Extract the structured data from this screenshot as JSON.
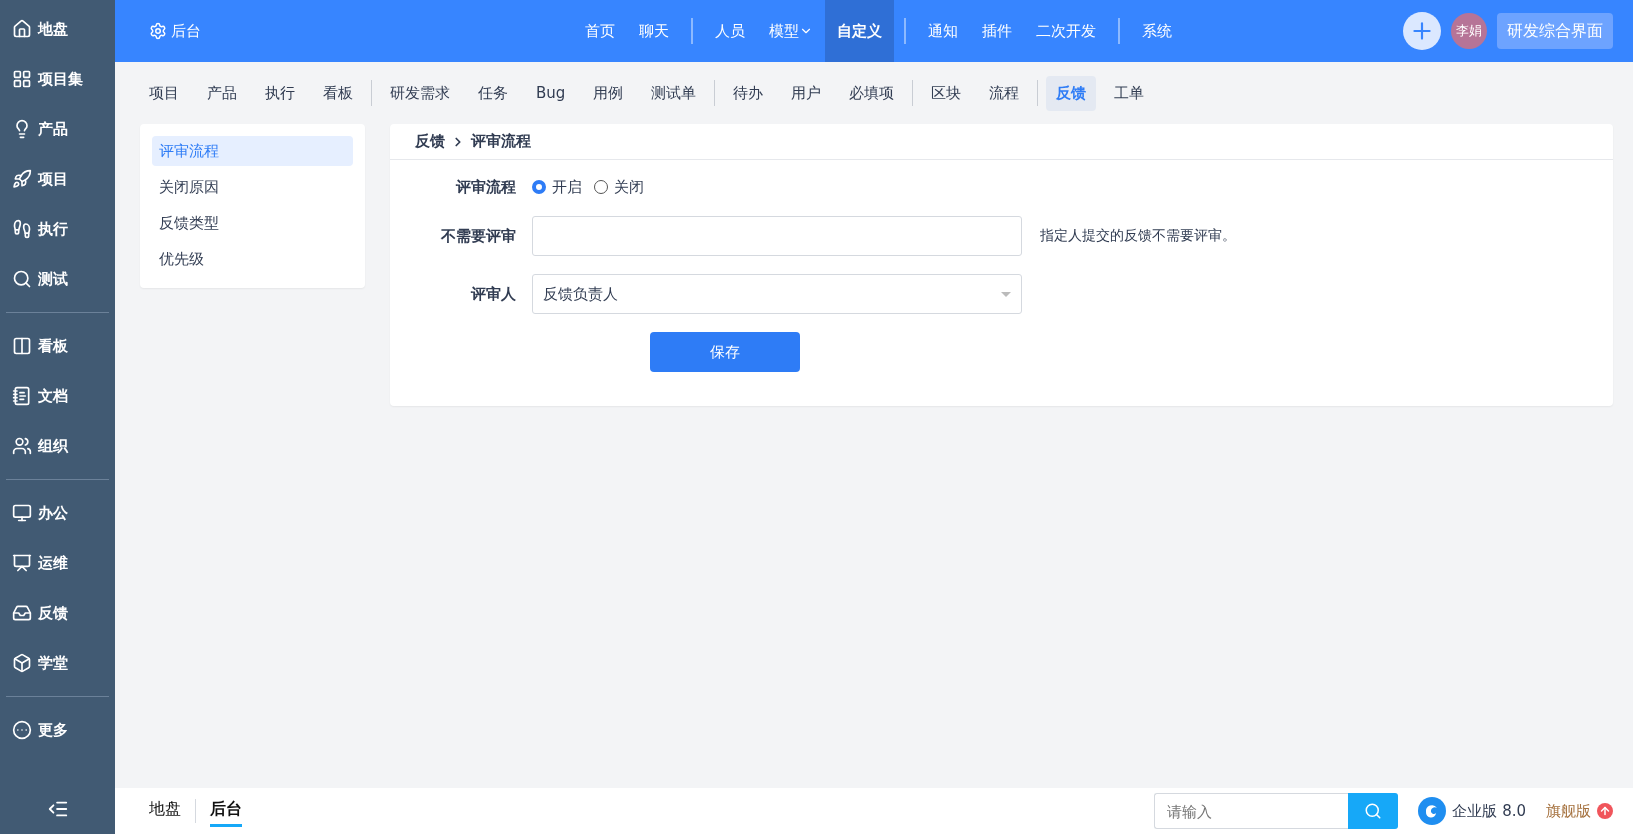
{
  "sidebar": {
    "groups": [
      {
        "items": [
          {
            "label": "地盘"
          },
          {
            "label": "项目集"
          },
          {
            "label": "产品"
          },
          {
            "label": "项目"
          },
          {
            "label": "执行"
          },
          {
            "label": "测试"
          }
        ]
      },
      {
        "items": [
          {
            "label": "看板"
          },
          {
            "label": "文档"
          },
          {
            "label": "组织"
          }
        ]
      },
      {
        "items": [
          {
            "label": "办公"
          },
          {
            "label": "运维"
          },
          {
            "label": "反馈"
          },
          {
            "label": "学堂"
          }
        ]
      },
      {
        "items": [
          {
            "label": "更多"
          }
        ]
      }
    ]
  },
  "topbar": {
    "title": "后台",
    "nav_groups": [
      [
        {
          "label": "首页",
          "selected": false,
          "has_menu": false
        },
        {
          "label": "聊天",
          "selected": false,
          "has_menu": false
        }
      ],
      [
        {
          "label": "人员",
          "selected": false,
          "has_menu": false
        },
        {
          "label": "模型",
          "selected": false,
          "has_menu": true
        },
        {
          "label": "自定义",
          "selected": true,
          "has_menu": false
        }
      ],
      [
        {
          "label": "通知",
          "selected": false,
          "has_menu": false
        },
        {
          "label": "插件",
          "selected": false,
          "has_menu": false
        },
        {
          "label": "二次开发",
          "selected": false,
          "has_menu": false
        }
      ],
      [
        {
          "label": "系统",
          "selected": false,
          "has_menu": false
        }
      ]
    ],
    "avatar": "李娟",
    "view": "研发综合界面"
  },
  "subnav": {
    "groups": [
      [
        {
          "label": "项目",
          "selected": false
        },
        {
          "label": "产品",
          "selected": false
        },
        {
          "label": "执行",
          "selected": false
        },
        {
          "label": "看板",
          "selected": false
        }
      ],
      [
        {
          "label": "研发需求",
          "selected": false
        },
        {
          "label": "任务",
          "selected": false
        },
        {
          "label": "Bug",
          "selected": false
        },
        {
          "label": "用例",
          "selected": false
        },
        {
          "label": "测试单",
          "selected": false
        }
      ],
      [
        {
          "label": "待办",
          "selected": false
        },
        {
          "label": "用户",
          "selected": false
        },
        {
          "label": "必填项",
          "selected": false
        }
      ],
      [
        {
          "label": "区块",
          "selected": false
        },
        {
          "label": "流程",
          "selected": false
        }
      ],
      [
        {
          "label": "反馈",
          "selected": true
        },
        {
          "label": "工单",
          "selected": false
        }
      ]
    ]
  },
  "side_menu": [
    {
      "label": "评审流程",
      "selected": true
    },
    {
      "label": "关闭原因",
      "selected": false
    },
    {
      "label": "反馈类型",
      "selected": false
    },
    {
      "label": "优先级",
      "selected": false
    }
  ],
  "breadcrumb": [
    "反馈",
    "评审流程"
  ],
  "form": {
    "rows": [
      {
        "kind": "radio",
        "label": "评审流程",
        "options": [
          {
            "label": "开启",
            "selected": true
          },
          {
            "label": "关闭",
            "selected": false
          }
        ]
      },
      {
        "kind": "input",
        "label": "不需要评审",
        "hint": "指定人提交的反馈不需要评审。"
      },
      {
        "kind": "select",
        "label": "评审人",
        "value": "反馈负责人"
      }
    ],
    "save": "保存"
  },
  "footer": {
    "tabs": [
      {
        "label": "地盘",
        "selected": false
      },
      {
        "label": "后台",
        "selected": true
      }
    ],
    "search": {
      "placeholder": "请输入"
    },
    "edition": "企业版 8.0",
    "upgrade": "旗舰版"
  }
}
